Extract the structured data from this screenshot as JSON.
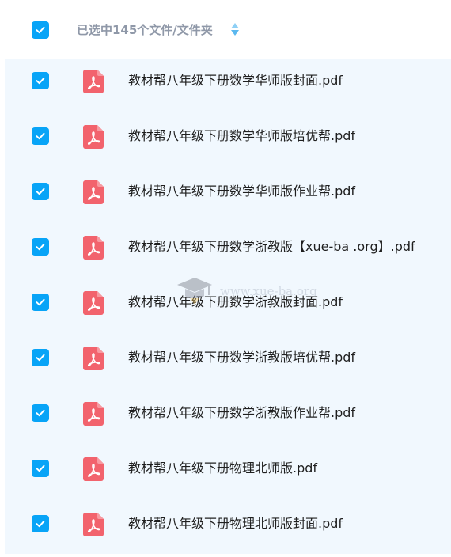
{
  "header": {
    "select_all_checked": true,
    "selection_label": "已选中145个文件/文件夹",
    "sort_icon": "sort-icon"
  },
  "colors": {
    "checkbox": "#08a4f7",
    "pdf_icon": "#f2636d",
    "list_background": "#f1f8fe"
  },
  "files": [
    {
      "name": "教材帮八年级下册数学华师版封面.pdf",
      "checked": true,
      "icon": "pdf-file-icon"
    },
    {
      "name": "教材帮八年级下册数学华师版培优帮.pdf",
      "checked": true,
      "icon": "pdf-file-icon"
    },
    {
      "name": "教材帮八年级下册数学华师版作业帮.pdf",
      "checked": true,
      "icon": "pdf-file-icon"
    },
    {
      "name": "教材帮八年级下册数学浙教版【xue-ba .org】.pdf",
      "checked": true,
      "icon": "pdf-file-icon"
    },
    {
      "name": "教材帮八年级下册数学浙教版封面.pdf",
      "checked": true,
      "icon": "pdf-file-icon"
    },
    {
      "name": "教材帮八年级下册数学浙教版培优帮.pdf",
      "checked": true,
      "icon": "pdf-file-icon"
    },
    {
      "name": "教材帮八年级下册数学浙教版作业帮.pdf",
      "checked": true,
      "icon": "pdf-file-icon"
    },
    {
      "name": "教材帮八年级下册物理北师版.pdf",
      "checked": true,
      "icon": "pdf-file-icon"
    },
    {
      "name": "教材帮八年级下册物理北师版封面.pdf",
      "checked": true,
      "icon": "pdf-file-icon"
    }
  ],
  "watermark": {
    "text": "www.xue-ba.org",
    "icon": "graduation-cap-icon"
  }
}
